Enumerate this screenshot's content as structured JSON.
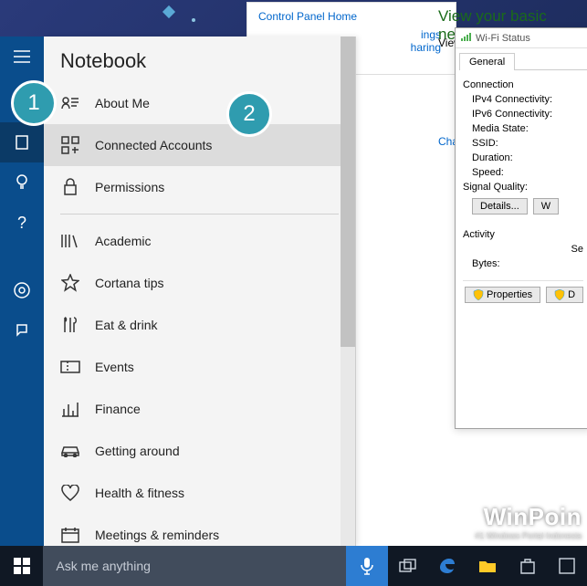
{
  "background": {
    "control_panel_home": "Control Panel Home",
    "settings_link_suffix": "ings",
    "sharing_link_suffix": "haring",
    "network_header": "View your basic netwo",
    "view_label": "View",
    "change_label": "Cha"
  },
  "cortana": {
    "panel_title": "Notebook",
    "items": [
      {
        "label": "About Me"
      },
      {
        "label": "Connected Accounts"
      },
      {
        "label": "Permissions"
      },
      {
        "label": "Academic"
      },
      {
        "label": "Cortana tips"
      },
      {
        "label": "Eat & drink"
      },
      {
        "label": "Events"
      },
      {
        "label": "Finance"
      },
      {
        "label": "Getting around"
      },
      {
        "label": "Health & fitness"
      },
      {
        "label": "Meetings & reminders"
      }
    ],
    "search_placeholder": "Ask me anything"
  },
  "wifi": {
    "title": "Wi-Fi Status",
    "tab": "General",
    "connection_head": "Connection",
    "ipv4": "IPv4 Connectivity:",
    "ipv6": "IPv6 Connectivity:",
    "media": "Media State:",
    "ssid": "SSID:",
    "duration": "Duration:",
    "speed": "Speed:",
    "sq": "Signal Quality:",
    "details_btn": "Details...",
    "w_btn": "W",
    "activity_head": "Activity",
    "se_label": "Se",
    "bytes": "Bytes:",
    "properties_btn": "Properties",
    "d_btn": "D"
  },
  "badges": {
    "one": "1",
    "two": "2"
  },
  "watermark": {
    "brand": "WinPoin",
    "tagline": "#1 Windows Portal Indonesia"
  }
}
